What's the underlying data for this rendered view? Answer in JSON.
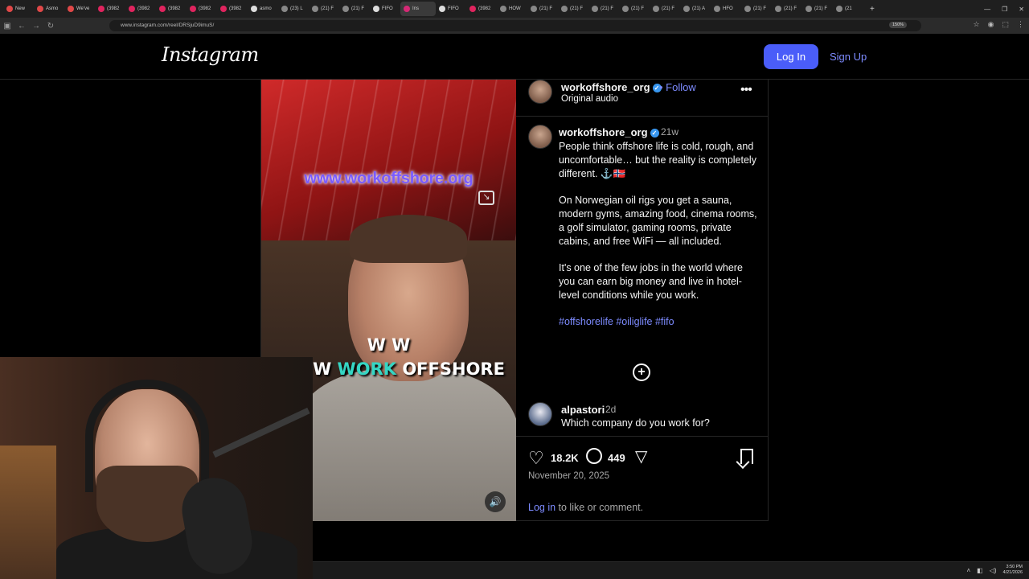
{
  "browser": {
    "tabs": [
      {
        "label": "New",
        "color": "#e04848"
      },
      {
        "label": "Asmo",
        "color": "#e04848"
      },
      {
        "label": "We've",
        "color": "#e04848"
      },
      {
        "label": "(3982",
        "color": "#e0245e"
      },
      {
        "label": "(3982",
        "color": "#e0245e"
      },
      {
        "label": "(3982",
        "color": "#e0245e"
      },
      {
        "label": "(3982",
        "color": "#e0245e"
      },
      {
        "label": "(3982",
        "color": "#e0245e"
      },
      {
        "label": "asmo",
        "color": "#dddddd"
      },
      {
        "label": "(23) L",
        "color": "#888888"
      },
      {
        "label": "(21) F",
        "color": "#888888"
      },
      {
        "label": "(21) F",
        "color": "#888888"
      },
      {
        "label": "FIFO",
        "color": "#dddddd"
      },
      {
        "label": "Ins",
        "color": "#d62976"
      },
      {
        "label": "FIFO",
        "color": "#dddddd"
      },
      {
        "label": "(3982",
        "color": "#e0245e"
      },
      {
        "label": "HOW",
        "color": "#888888"
      },
      {
        "label": "(21) F",
        "color": "#888888"
      },
      {
        "label": "(21) F",
        "color": "#888888"
      },
      {
        "label": "(21) F",
        "color": "#888888"
      },
      {
        "label": "(21) F",
        "color": "#888888"
      },
      {
        "label": "(21) F",
        "color": "#888888"
      },
      {
        "label": "(21) A",
        "color": "#888888"
      },
      {
        "label": "HFO",
        "color": "#888888"
      },
      {
        "label": "(21) F",
        "color": "#888888"
      },
      {
        "label": "(21) F",
        "color": "#888888"
      },
      {
        "label": "(21) F",
        "color": "#888888"
      },
      {
        "label": "(21",
        "color": "#888888"
      }
    ],
    "active_tab_index": 13,
    "new_tab": "+",
    "url": "www.instagram.com/reel/DRSjuD9imuS/",
    "zoom": "150%",
    "win_min": "—",
    "win_max": "❐",
    "win_close": "✕"
  },
  "header": {
    "logo": "Instagram",
    "login_label": "Log In",
    "signup_label": "Sign Up"
  },
  "video": {
    "watermark": "www.workoffshore.org",
    "subtitle_line1": "W W",
    "subtitle_line2_prefix": "W ",
    "subtitle_line2_highlight": "WORK",
    "subtitle_line2_suffix": " OFFSHORE",
    "highlight_color": "#35d6c4"
  },
  "post": {
    "username": "workoffshore_org",
    "follow_label": "Follow",
    "audio_label": "Original audio",
    "time_ago": "21w",
    "caption_paragraphs": [
      "People think offshore life is cold, rough, and uncomfortable… but the reality is completely different. ⚓🇳🇴",
      "On Norwegian oil rigs you get a sauna, modern gyms, amazing food, cinema rooms, a golf simulator, gaming rooms, private cabins, and free WiFi — all included.",
      "It's one of the few jobs in the world where you can earn big money and live in hotel-level conditions while you work."
    ],
    "hashtags": "#offshorelife #oiliglife #fifo",
    "likes": "18.2K",
    "comments": "449",
    "date": "November 20, 2025",
    "login_prompt_link": "Log in",
    "login_prompt_text": " to like or comment."
  },
  "comment": {
    "username": "alpastori",
    "time_ago": "2d",
    "text": "Which company do you work for?"
  },
  "taskbar": {
    "time": "3:50 PM",
    "date": "4/21/2026"
  }
}
